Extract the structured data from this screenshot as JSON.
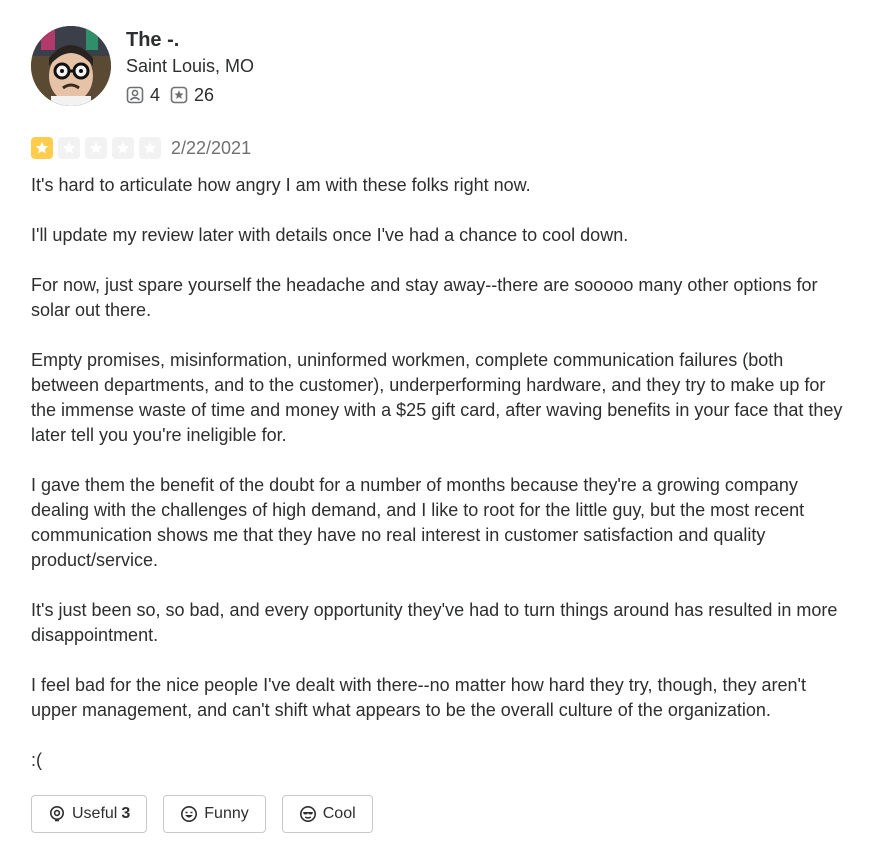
{
  "user": {
    "name": "The -.",
    "location": "Saint Louis, MO",
    "friends_count": "4",
    "reviews_count": "26"
  },
  "review": {
    "rating": 1,
    "rating_max": 5,
    "date": "2/22/2021",
    "paragraphs": [
      "It's hard to articulate how angry I am with these folks right now.",
      "I'll update my review later with details once I've had a chance to cool down.",
      "For now, just spare yourself the headache and stay away--there are sooooo many other options for solar out there.",
      "Empty promises, misinformation, uninformed workmen, complete communication failures (both between departments, and to the customer), underperforming hardware, and they try to make up for the immense waste of time and money with a $25 gift card, after waving benefits in your  face that they later tell you you're ineligible for.",
      "I gave them the benefit of the doubt for a number of months because they're a growing company dealing with the challenges of high demand, and I like to root for the little guy, but the most recent communication shows me that they have no real interest in customer satisfaction and quality product/service.",
      "It's just been so, so bad, and every opportunity they've had to turn things around has resulted in more disappointment.",
      "I feel bad for the nice people I've dealt with there--no matter how hard they try, though, they aren't upper management, and can't shift what appears to be the overall culture of the organization.",
      ":("
    ]
  },
  "actions": {
    "useful_label": "Useful",
    "useful_count": "3",
    "funny_label": "Funny",
    "cool_label": "Cool"
  },
  "colors": {
    "star_on": "#ffcc4b",
    "star_off": "#f2f2f2",
    "text": "#2d2e2f",
    "muted": "#6e7072",
    "border": "#c8c9ca"
  }
}
